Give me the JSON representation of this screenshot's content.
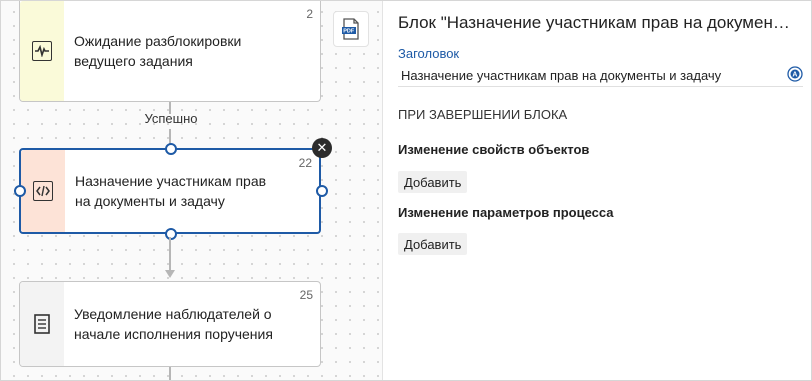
{
  "canvas": {
    "edge_label": "Успешно",
    "nodes": [
      {
        "number": "2",
        "title": "Ожидание разблокировки ведущего задания",
        "icon": "activity-icon"
      },
      {
        "number": "22",
        "title": "Назначение участникам прав на документы и задачу",
        "icon": "code-icon"
      },
      {
        "number": "25",
        "title": "Уведомление наблюдателей о начале исполнения поручения",
        "icon": "document-icon"
      }
    ],
    "toolbar_icon": "pdf-export-icon",
    "colors": {
      "selected_border": "#1e5aa6",
      "node1_side": "#fafad9",
      "node2_side": "#fde3d7",
      "node3_side": "#f3f3f3"
    }
  },
  "panel": {
    "title": "Блок \"Назначение участникам прав на документы и задачу\"",
    "field_label": "Заголовок",
    "field_value": "Назначение участникам прав на документы и задачу",
    "section_title": "ПРИ ЗАВЕРШЕНИИ БЛОКА",
    "groups": [
      {
        "title": "Изменение свойств объектов",
        "button": "Добавить"
      },
      {
        "title": "Изменение параметров процесса",
        "button": "Добавить"
      }
    ]
  }
}
